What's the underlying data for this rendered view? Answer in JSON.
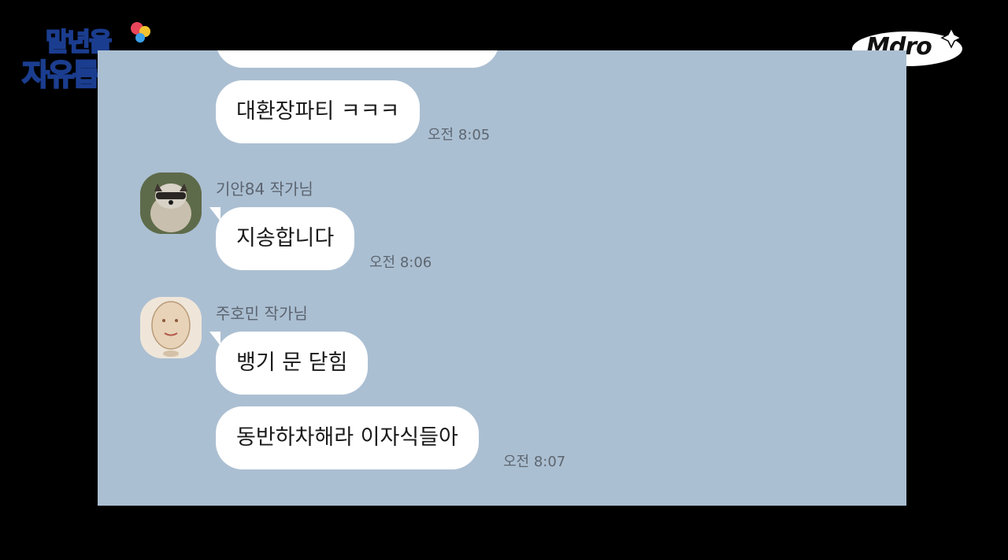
{
  "show_logo": {
    "line1": "말년을",
    "line2": "자유롭게"
  },
  "channel_logo": "Mdro",
  "messages": {
    "top_cut_text": "",
    "m1": {
      "text": "대환장파티 ㅋㅋㅋ",
      "time": "오전 8:05"
    },
    "m2": {
      "sender": "기안84 작가님",
      "text": "지송합니다",
      "time": "오전 8:06",
      "avatar_icon": "raccoon-avatar-icon"
    },
    "m3": {
      "sender": "주호민 작가님",
      "text": "뱅기 문 닫힘",
      "avatar_icon": "drawn-face-avatar-icon"
    },
    "m4": {
      "text": "동반하차해라 이자식들아",
      "time": "오전 8:07"
    }
  },
  "colors": {
    "chat_bg": "#abbfd2",
    "bubble": "#ffffff",
    "frame": "#000000"
  }
}
